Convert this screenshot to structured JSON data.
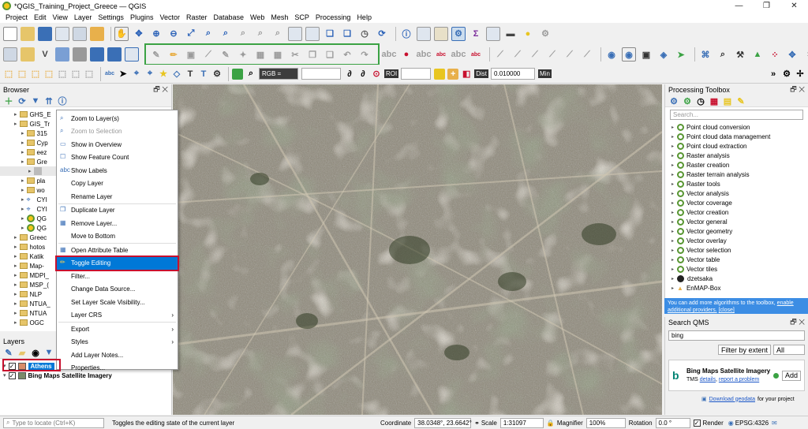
{
  "title": "*QGIS_Training_Project_Greece — QGIS",
  "menu": [
    "Project",
    "Edit",
    "View",
    "Layer",
    "Settings",
    "Plugins",
    "Vector",
    "Raster",
    "Database",
    "Web",
    "Mesh",
    "SCP",
    "Processing",
    "Help"
  ],
  "toolbar": {
    "band_combo": "RGB =",
    "roi_label": "ROI",
    "dist_label": "Dist",
    "dist_value": "0.010000",
    "min_label": "Min"
  },
  "browser": {
    "title": "Browser",
    "items": [
      {
        "label": "GHS_E",
        "icon": "folder",
        "indent": 2
      },
      {
        "label": "GIS_Tr",
        "icon": "folder",
        "indent": 2
      },
      {
        "label": "315",
        "icon": "folder",
        "indent": 3
      },
      {
        "label": "Cyp",
        "icon": "folder",
        "indent": 3
      },
      {
        "label": "eez",
        "icon": "folder",
        "indent": 3
      },
      {
        "label": "Gre",
        "icon": "folder",
        "indent": 3
      },
      {
        "label": "",
        "icon": "layer",
        "indent": 4
      },
      {
        "label": "pla",
        "icon": "folder",
        "indent": 3
      },
      {
        "label": "wo",
        "icon": "folder",
        "indent": 3
      },
      {
        "label": "CYI",
        "icon": "vector",
        "indent": 3
      },
      {
        "label": "CYI",
        "icon": "vector",
        "indent": 3
      },
      {
        "label": "QG",
        "icon": "qgis",
        "indent": 3
      },
      {
        "label": "QG",
        "icon": "qgis",
        "indent": 3
      },
      {
        "label": "Greec",
        "icon": "folder",
        "indent": 2
      },
      {
        "label": "hotos",
        "icon": "folder",
        "indent": 2
      },
      {
        "label": "Katik",
        "icon": "folder",
        "indent": 2
      },
      {
        "label": "Map-",
        "icon": "folder",
        "indent": 2
      },
      {
        "label": "MDPI_",
        "icon": "folder",
        "indent": 2
      },
      {
        "label": "MSP_(",
        "icon": "folder",
        "indent": 2
      },
      {
        "label": "NLP",
        "icon": "folder",
        "indent": 2
      },
      {
        "label": "NTUA_",
        "icon": "folder",
        "indent": 2
      },
      {
        "label": "NTUA",
        "icon": "folder",
        "indent": 2
      },
      {
        "label": "OGC",
        "icon": "folder",
        "indent": 2
      }
    ]
  },
  "layers": {
    "title": "Layers",
    "items": [
      {
        "label": "Athens",
        "checked": true,
        "selected": true
      },
      {
        "label": "Bing Maps Satellite Imagery",
        "checked": true,
        "selected": false
      }
    ]
  },
  "context_menu": {
    "items": [
      {
        "label": "Zoom to Layer(s)",
        "icon": "zoom-layer-icon",
        "disabled": false
      },
      {
        "label": "Zoom to Selection",
        "icon": "zoom-selection-icon",
        "disabled": true
      },
      {
        "label": "Show in Overview",
        "icon": "overview-icon",
        "disabled": false
      },
      {
        "label": "Show Feature Count",
        "icon": "checkbox-icon",
        "disabled": false,
        "sep_after": false
      },
      {
        "label": "Show Labels",
        "icon": "labels-icon",
        "disabled": false
      },
      {
        "label": "Copy Layer",
        "icon": "",
        "disabled": false
      },
      {
        "label": "Rename Layer",
        "icon": "",
        "disabled": false,
        "sep_after": true
      },
      {
        "label": "Duplicate Layer",
        "icon": "duplicate-icon",
        "disabled": false
      },
      {
        "label": "Remove Layer...",
        "icon": "remove-icon",
        "disabled": false
      },
      {
        "label": "Move to Bottom",
        "icon": "",
        "disabled": false,
        "sep_after": true
      },
      {
        "label": "Open Attribute Table",
        "icon": "table-icon",
        "disabled": false
      },
      {
        "label": "Toggle Editing",
        "icon": "pencil-icon",
        "disabled": false,
        "highlighted": true
      },
      {
        "label": "Filter...",
        "icon": "",
        "disabled": false
      },
      {
        "label": "Change Data Source...",
        "icon": "",
        "disabled": false
      },
      {
        "label": "Set Layer Scale Visibility...",
        "icon": "",
        "disabled": false
      },
      {
        "label": "Layer CRS",
        "icon": "",
        "disabled": false,
        "submenu": true,
        "sep_after": true
      },
      {
        "label": "Export",
        "icon": "",
        "disabled": false,
        "submenu": true
      },
      {
        "label": "Styles",
        "icon": "",
        "disabled": false,
        "submenu": true
      },
      {
        "label": "Add Layer Notes...",
        "icon": "",
        "disabled": false
      },
      {
        "label": "Properties...",
        "icon": "",
        "disabled": false
      }
    ]
  },
  "toolbox": {
    "title": "Processing Toolbox",
    "search_placeholder": "Search...",
    "items": [
      "Point cloud conversion",
      "Point cloud data management",
      "Point cloud extraction",
      "Raster analysis",
      "Raster creation",
      "Raster terrain analysis",
      "Raster tools",
      "Vector analysis",
      "Vector coverage",
      "Vector creation",
      "Vector general",
      "Vector geometry",
      "Vector overlay",
      "Vector selection",
      "Vector table",
      "Vector tiles",
      "dzetsaka",
      "EnMAP-Box"
    ],
    "info_text": "You can add more algorithms to the toolbox,",
    "info_link1": "enable additional providers.",
    "info_link2": "[close]"
  },
  "qms": {
    "title": "Search QMS",
    "search_value": "bing",
    "filter_button": "Filter by extent",
    "scope_value": "All",
    "result_title": "Bing Maps Satellite Imagery",
    "result_type": "TMS",
    "result_details": "details",
    "result_report": "report a problem",
    "add_button": "Add",
    "download_link": "Download geodata",
    "download_suffix": "for your project"
  },
  "status": {
    "locate_placeholder": "Type to locate (Ctrl+K)",
    "message": "Toggles the editing state of the current layer",
    "coordinate_label": "Coordinate",
    "coordinate_value": "38.0348°, 23.6642°",
    "scale_label": "Scale",
    "scale_value": "1:31097",
    "magnifier_label": "Magnifier",
    "magnifier_value": "100%",
    "rotation_label": "Rotation",
    "rotation_value": "0.0 °",
    "render_label": "Render",
    "crs": "EPSG:4326"
  },
  "colors": {
    "highlight": "#0078d7",
    "annotation_red": "#c8102e",
    "annotation_green": "#3ba244",
    "qgis_green": "#589632",
    "qgis_yellow": "#f3c518"
  }
}
